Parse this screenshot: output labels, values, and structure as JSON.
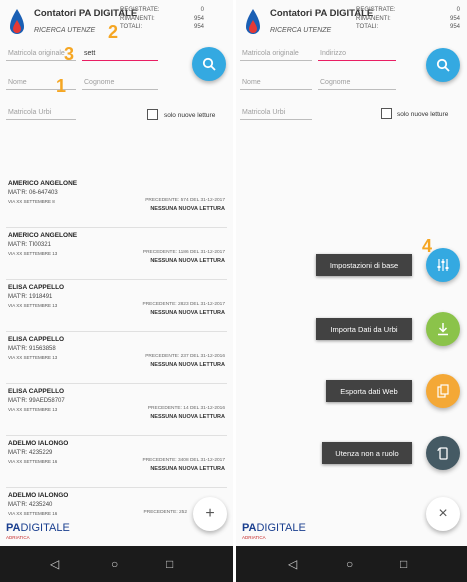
{
  "app": {
    "title": "Contatori PA DIGITALE",
    "subtitle": "RICERCA UTENZE",
    "stats": [
      {
        "label": "REGISTRATE:",
        "value": "0"
      },
      {
        "label": "RIMANENTI:",
        "value": "954"
      },
      {
        "label": "TOTALI:",
        "value": "954"
      }
    ]
  },
  "left": {
    "fields": {
      "matricola_originale": "Matricola originale",
      "indirizzo_value": "sett",
      "nome": "Nome",
      "cognome": "Cognome",
      "matricola_urbi": "Matricola Urbi"
    },
    "checkbox_label": "solo nuove letture",
    "annotations": [
      "1",
      "2",
      "3"
    ],
    "list": [
      {
        "name": "AMERICO ANGELONE",
        "mat": "MAT'R: 06-647403",
        "addr": "VIA XX SETTEMBRE 8",
        "prev": "PRECEDENTE: 574 DEL 31-12-2017",
        "status": "NESSUNA NUOVA LETTURA"
      },
      {
        "name": "AMERICO ANGELONE",
        "mat": "MAT'R: TI00321",
        "addr": "VIA XX SETTEMBRE 13",
        "prev": "PRECEDENTE: 1186 DEL 31-12-2017",
        "status": "NESSUNA NUOVA LETTURA"
      },
      {
        "name": "ELISA CAPPELLO",
        "mat": "MAT'R: 1918491",
        "addr": "VIA XX SETTEMBRE 13",
        "prev": "PRECEDENTE: 2823 DEL 31-12-2017",
        "status": "NESSUNA NUOVA LETTURA"
      },
      {
        "name": "ELISA CAPPELLO",
        "mat": "MAT'R: 91563858",
        "addr": "VIA XX SETTEMBRE 13",
        "prev": "PRECEDENTE: 237 DEL 31-12-2016",
        "status": "NESSUNA NUOVA LETTURA"
      },
      {
        "name": "ELISA CAPPELLO",
        "mat": "MAT'R: 99AED58707",
        "addr": "VIA XX SETTEMBRE 13",
        "prev": "PRECEDENTE: 14 DEL 31-12-2016",
        "status": "NESSUNA NUOVA LETTURA"
      },
      {
        "name": "ADELMO IALONGO",
        "mat": "MAT'R: 4235229",
        "addr": "VIA XX SETTEMBRE 16",
        "prev": "PRECEDENTE: 3408 DEL 31-12-2017",
        "status": "NESSUNA NUOVA LETTURA"
      },
      {
        "name": "ADELMO IALONGO",
        "mat": "MAT'R: 4235240",
        "addr": "VIA XX SETTEMBRE 16",
        "prev": "PRECEDENTE: 252",
        "status": ""
      }
    ],
    "fab_plus": "+"
  },
  "right": {
    "fields": {
      "matricola_originale": "Matricola originale",
      "indirizzo": "Indirizzo",
      "nome": "Nome",
      "cognome": "Cognome",
      "matricola_urbi": "Matricola Urbi"
    },
    "checkbox_label": "solo nuove letture",
    "annotation": "4",
    "menu": [
      {
        "label": "Impostazioni di base",
        "color": "#34a9e1",
        "icon": "settings-sliders-icon"
      },
      {
        "label": "Importa Dati da Urbi",
        "color": "#8bc34a",
        "icon": "download-icon"
      },
      {
        "label": "Esporta dati Web",
        "color": "#f4a836",
        "icon": "export-icon"
      },
      {
        "label": "Utenza non a ruolo",
        "color": "#455a64",
        "icon": "rotate-device-icon"
      }
    ],
    "fab_close": "×"
  },
  "brand": {
    "pa": "PA",
    "digitale": "DIGITALE",
    "sub": "ADRIATICA"
  },
  "nav": {
    "back": "◁",
    "home": "○",
    "recent": "□"
  },
  "colors": {
    "accent": "#34a9e1",
    "annotation": "#f5a623",
    "active_underline": "#e91e63"
  }
}
